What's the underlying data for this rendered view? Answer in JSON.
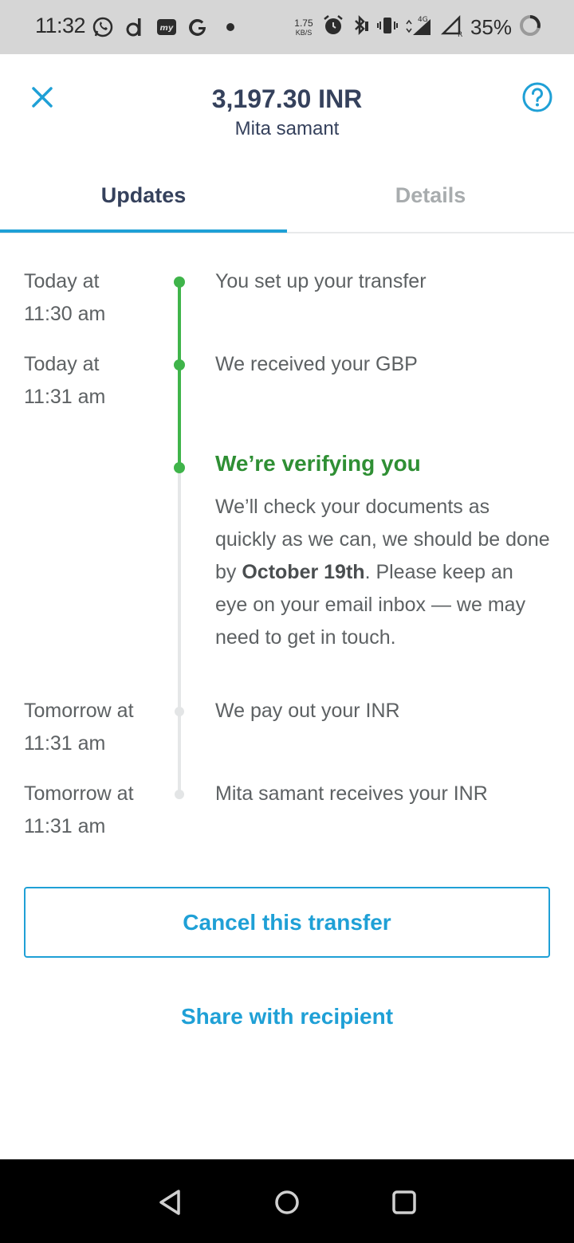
{
  "status_bar": {
    "time": "11:32",
    "speed_top": "1.75",
    "speed_bottom": "KB/S",
    "network": "4G",
    "battery": "35%",
    "icons": [
      "whatsapp-icon",
      "d-app-icon",
      "myapp-icon",
      "google-icon",
      "dot-icon",
      "alarm-icon",
      "bluetooth-icon",
      "vibrate-icon",
      "signal-icon",
      "signal-roaming-icon",
      "battery-icon"
    ]
  },
  "header": {
    "amount": "3,197.30 INR",
    "recipient": "Mita samant"
  },
  "tabs": [
    {
      "label": "Updates",
      "active": true
    },
    {
      "label": "Details",
      "active": false
    }
  ],
  "timeline": [
    {
      "time_line1": "Today at",
      "time_line2": "11:30 am",
      "text": "You set up your transfer",
      "status": "done"
    },
    {
      "time_line1": "Today at",
      "time_line2": "11:31 am",
      "text": "We received your GBP",
      "status": "done"
    },
    {
      "title": "We’re verifying you",
      "desc_part1": "We’ll check your documents as quickly as we can, we should be done by ",
      "desc_bold": "October 19th",
      "desc_part2": ". Please keep an eye on your email inbox — we may need to get in touch.",
      "status": "current"
    },
    {
      "time_line1": "Tomorrow at",
      "time_line2": "11:31 am",
      "text": "We pay out your INR",
      "status": "pending"
    },
    {
      "time_line1": "Tomorrow at",
      "time_line2": "11:31 am",
      "text": "Mita samant receives your INR",
      "status": "pending"
    }
  ],
  "actions": {
    "cancel_label": "Cancel this transfer",
    "share_label": "Share with recipient"
  },
  "colors": {
    "accent": "#1fa0d6",
    "navy": "#35415c",
    "green": "#3fb44a",
    "green_text": "#2f8f34",
    "text": "#5d6163",
    "inactive_tab": "#a8acae"
  }
}
